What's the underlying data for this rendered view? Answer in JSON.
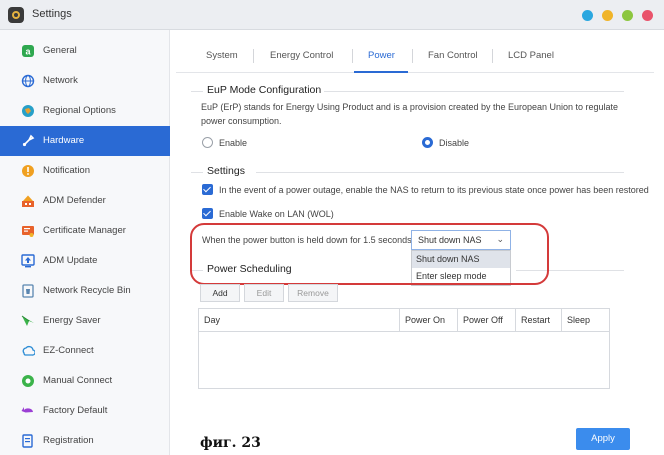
{
  "window": {
    "title": "Settings",
    "dot_colors": [
      "#2aa7e0",
      "#f0b429",
      "#8cc63f",
      "#e9536b"
    ]
  },
  "sidebar": {
    "active_index": 3,
    "items": [
      {
        "label": "General",
        "icon": "general-icon",
        "color": "#2fa84f"
      },
      {
        "label": "Network",
        "icon": "globe-icon",
        "color": "#2a6ad4"
      },
      {
        "label": "Regional Options",
        "icon": "regional-icon",
        "color": "#27a0c8"
      },
      {
        "label": "Hardware",
        "icon": "hardware-icon",
        "color": "#ffffff"
      },
      {
        "label": "Notification",
        "icon": "notification-icon",
        "color": "#f0a020"
      },
      {
        "label": "ADM Defender",
        "icon": "defender-icon",
        "color": "#e87722"
      },
      {
        "label": "Certificate Manager",
        "icon": "certificate-icon",
        "color": "#e8622a"
      },
      {
        "label": "ADM Update",
        "icon": "update-icon",
        "color": "#2a6ad4"
      },
      {
        "label": "Network Recycle Bin",
        "icon": "recycle-bin-icon",
        "color": "#5a86b0"
      },
      {
        "label": "Energy Saver",
        "icon": "energy-saver-icon",
        "color": "#3bb34a"
      },
      {
        "label": "EZ-Connect",
        "icon": "ez-connect-icon",
        "color": "#2a8bd4"
      },
      {
        "label": "Manual Connect",
        "icon": "manual-connect-icon",
        "color": "#3bb34a"
      },
      {
        "label": "Factory Default",
        "icon": "factory-default-icon",
        "color": "#9b3fd4"
      },
      {
        "label": "Registration",
        "icon": "registration-icon",
        "color": "#2a6ad4"
      }
    ]
  },
  "tabs": {
    "active_index": 2,
    "items": [
      "System",
      "Energy Control",
      "Power",
      "Fan Control",
      "LCD Panel"
    ]
  },
  "eup": {
    "title": "EuP Mode Configuration",
    "description": "EuP (ErP) stands for Energy Using Product and is a provision created by the European Union to regulate power consumption.",
    "enable_label": "Enable",
    "disable_label": "Disable",
    "selected": "Disable"
  },
  "settings": {
    "title": "Settings",
    "restore_power_label": "In the event of a power outage, enable the NAS to return to its previous state once power has been restored",
    "restore_power_checked": true,
    "wol_label": "Enable Wake on LAN (WOL)",
    "wol_checked": true,
    "power_button_label": "When the power button is held down for 1.5 seconds:",
    "power_button_value": "Shut down NAS",
    "power_button_options": [
      "Shut down NAS",
      "Enter sleep mode"
    ],
    "highlight_color": "#d43a3a"
  },
  "scheduling": {
    "title": "Power Scheduling",
    "add_label": "Add",
    "edit_label": "Edit",
    "remove_label": "Remove",
    "columns": [
      "Day",
      "Power On",
      "Power Off",
      "Restart",
      "Sleep"
    ],
    "rows": []
  },
  "footer": {
    "apply_label": "Apply",
    "caption": "фиг. 23"
  },
  "colors": {
    "accent": "#2a6ad4",
    "apply": "#3b8ced"
  }
}
